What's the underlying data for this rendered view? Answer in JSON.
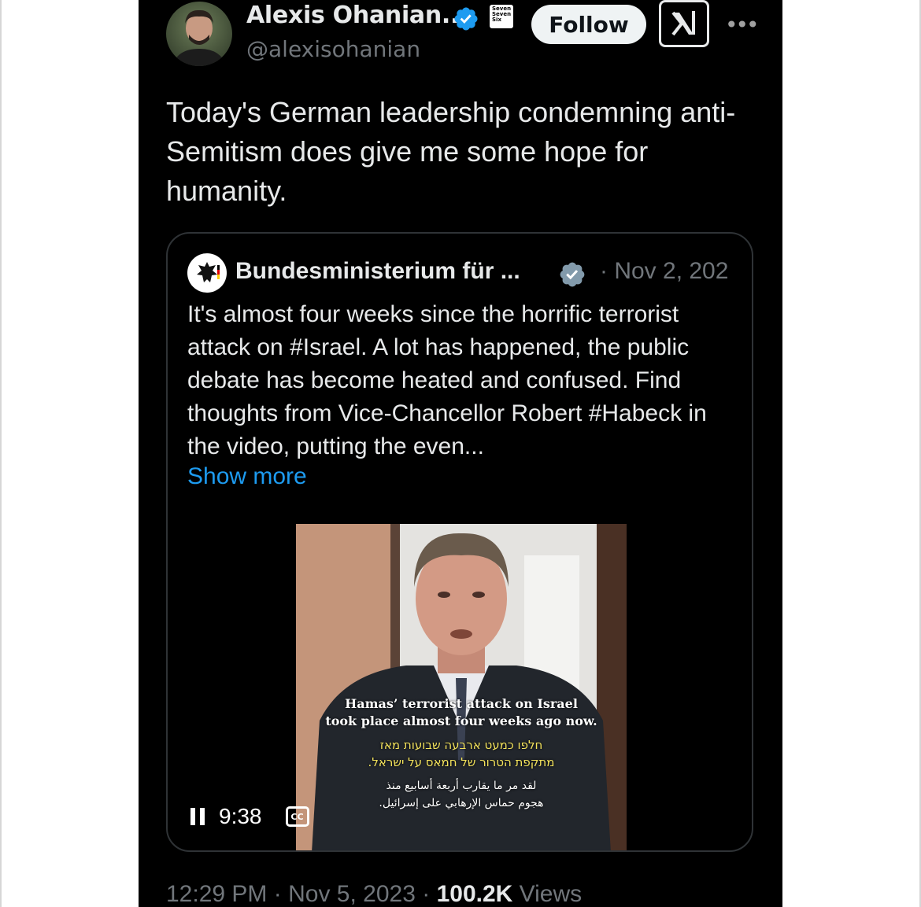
{
  "post": {
    "author_name": "Alexis Ohanian...",
    "author_handle": "@alexisohanian",
    "affiliate_badge_text": "Seven Seven Six",
    "follow_label": "Follow",
    "more_icon": "more-horizontal-icon",
    "text": "Today's German leadership condemning anti-Semitism does give me some hope for humanity.",
    "time": "12:29 PM",
    "date": "Nov 5, 2023",
    "views_count": "100.2K",
    "views_label": "Views",
    "separator": "·"
  },
  "quote": {
    "author_name": "Bundesministerium für ...",
    "date": "· Nov 2, 202",
    "text": "It's almost four weeks since the horrific terrorist attack on #Israel. A lot has happened, the public debate has become heated and confused. Find thoughts from Vice-Chancellor Robert #Habeck in the video, putting the even...",
    "show_more": "Show more"
  },
  "video": {
    "subtitle_en_1": "Hamas’ terrorist attack on Israel",
    "subtitle_en_2": "took place almost four weeks ago now.",
    "subtitle_he_1": "חלפו כמעט ארבעה שבועות מאז",
    "subtitle_he_2": "מתקפת הטרור של חמאס על ישראל.",
    "subtitle_ar_1": "لقد مر ما يقارب أربعة أسابيع منذ",
    "subtitle_ar_2": "هجوم حماس الإرهابي على إسرائيل.",
    "time_remaining": "9:38",
    "cc_label": "CC"
  },
  "colors": {
    "background": "#000000",
    "text": "#e7e9ea",
    "secondary": "#71767b",
    "link": "#1d9bf0",
    "verified": "#1d9bf0"
  }
}
